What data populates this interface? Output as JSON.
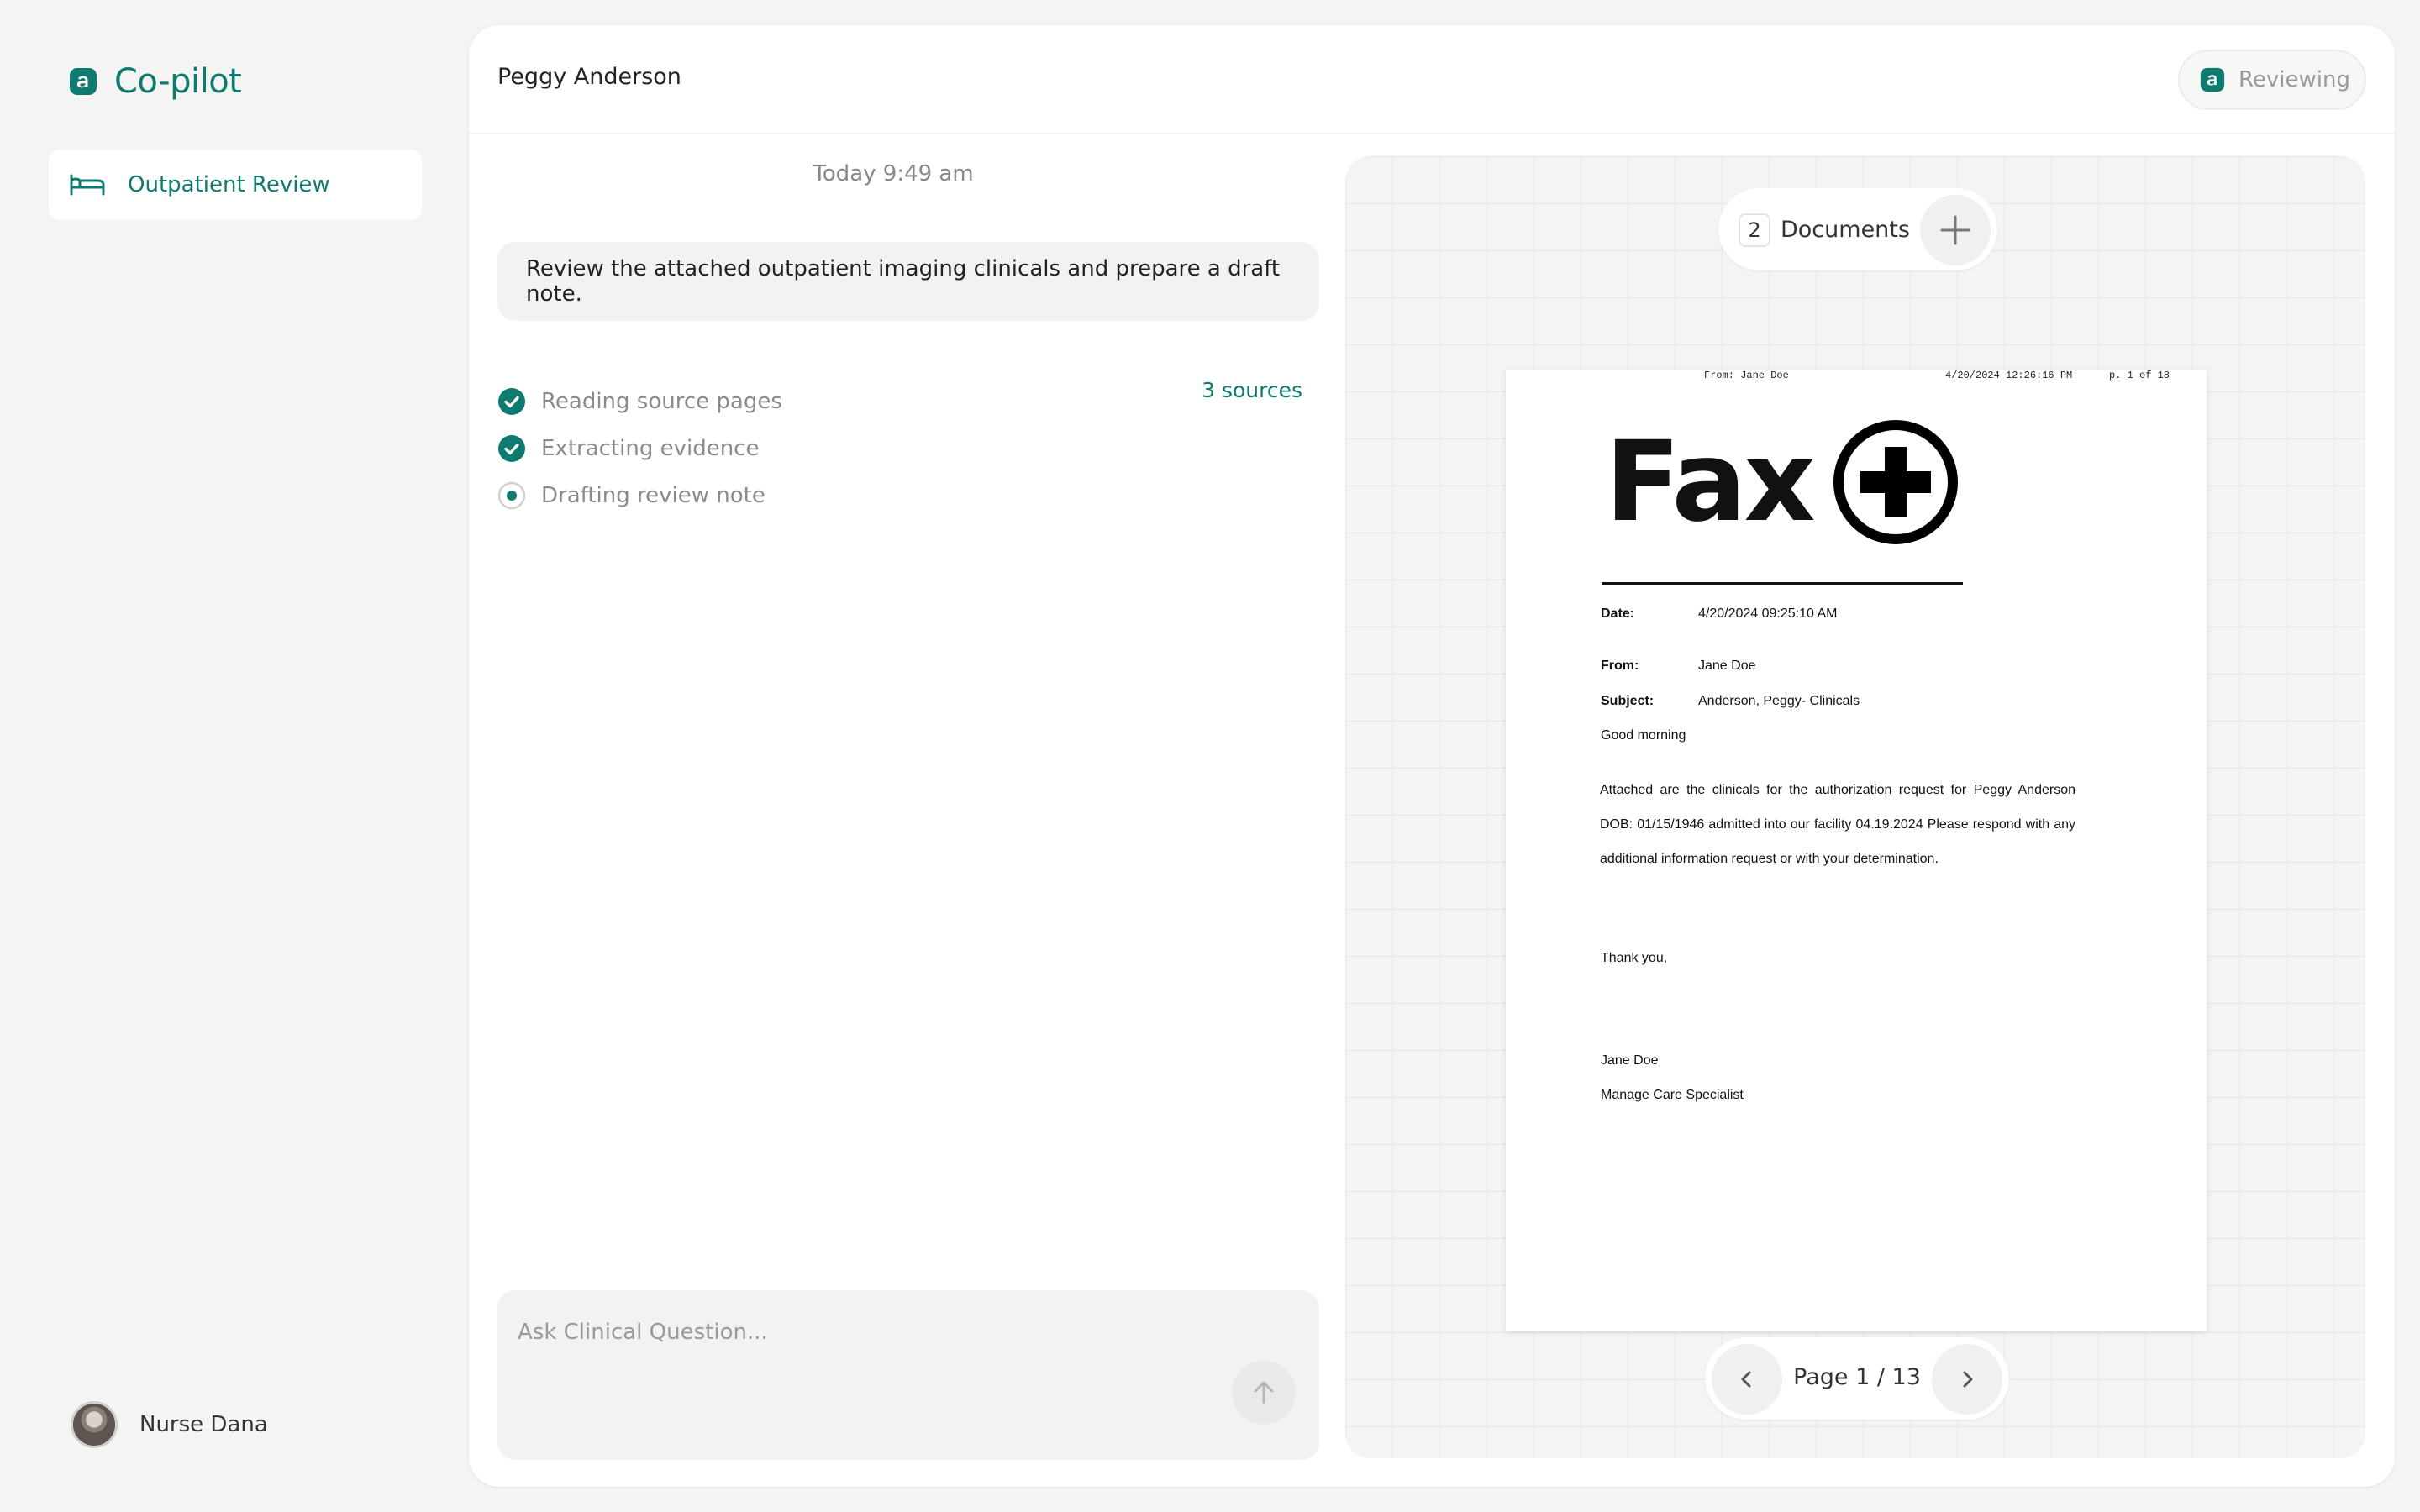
{
  "colors": {
    "accent": "#0f7a6f",
    "background": "#f4f4f2"
  },
  "sidebar": {
    "brand": {
      "icon": "app-logo-icon",
      "name": "Co-pilot"
    },
    "items": [
      {
        "label": "Outpatient Review",
        "icon": "bed-icon",
        "active": true
      }
    ],
    "user": {
      "name": "Nurse Dana",
      "avatar": "avatar"
    }
  },
  "header": {
    "patient_name": "Peggy Anderson",
    "status": {
      "label": "Reviewing",
      "icon": "app-logo-icon"
    }
  },
  "chat": {
    "timestamp": "Today 9:49 am",
    "message": "Review the attached outpatient imaging clinicals and prepare a draft note.",
    "sources_label": "3 sources",
    "steps": [
      {
        "label": "Reading source pages",
        "state": "done"
      },
      {
        "label": "Extracting evidence",
        "state": "done"
      },
      {
        "label": "Drafting review note",
        "state": "in-progress"
      }
    ],
    "composer": {
      "placeholder": "Ask Clinical Question...",
      "value": "",
      "send_icon": "arrow-up-icon"
    }
  },
  "viewer": {
    "documents_count": "2",
    "documents_label": "Documents",
    "add_icon": "plus-icon",
    "page_label": "Page 1 / 13",
    "prev_icon": "chevron-left-icon",
    "next_icon": "chevron-right-icon",
    "fax": {
      "topline_from": "From: Jane Doe",
      "topline_timestamp": "4/20/2024 12:26:16 PM",
      "topline_page": "p. 1 of 18",
      "logo_text": "Fax",
      "date_label": "Date:",
      "date_value": "4/20/2024 09:25:10 AM",
      "from_label": "From:",
      "from_value": "Jane Doe",
      "subject_label": "Subject:",
      "subject_value": "Anderson, Peggy- Clinicals",
      "greeting": "Good morning",
      "body": "Attached are the clinicals for the authorization request for Peggy Anderson DOB: 01/15/1946 admitted into our facility 04.19.2024 Please respond with any additional information request or with your determination.",
      "closing": "Thank you,",
      "signature_name": "Jane Doe",
      "signature_title": "Manage Care Specialist"
    }
  }
}
